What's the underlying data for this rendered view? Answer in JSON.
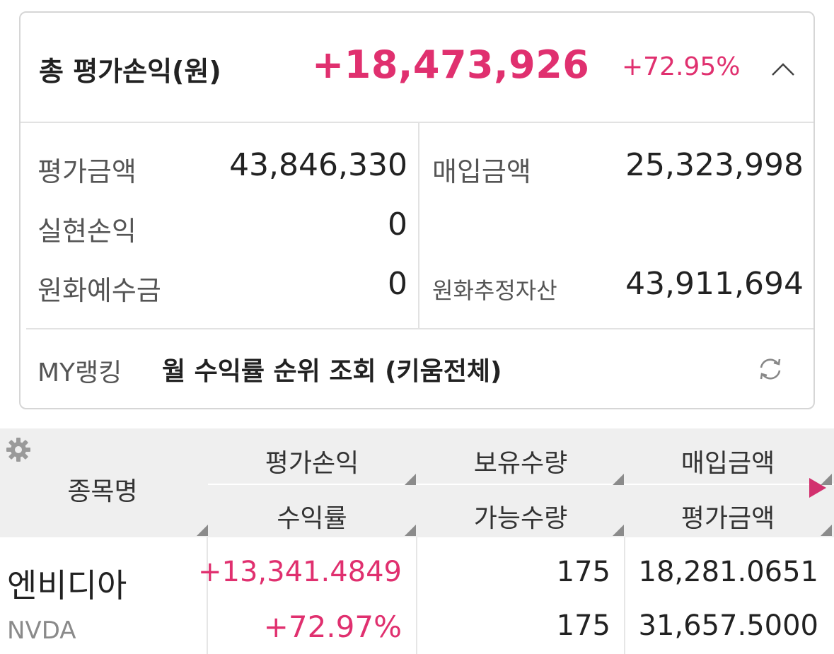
{
  "summary": {
    "total_label": "총 평가손익(원)",
    "total_value": "+18,473,926",
    "total_rate": "+72.95%",
    "eval_amount_label": "평가금액",
    "eval_amount_value": "43,846,330",
    "purchase_amount_label": "매입금액",
    "purchase_amount_value": "25,323,998",
    "realized_pl_label": "실현손익",
    "realized_pl_value": "0",
    "krw_deposit_label": "원화예수금",
    "krw_deposit_value": "0",
    "krw_est_assets_label": "원화추정자산",
    "krw_est_assets_value": "43,911,694"
  },
  "ranking": {
    "label": "MY랭킹",
    "title": "월 수익률 순위 조회 (키움전체)"
  },
  "table": {
    "headers": {
      "name": "종목명",
      "eval_pl": "평가손익",
      "return_rate": "수익률",
      "holding_qty": "보유수량",
      "available_qty": "가능수량",
      "purchase_amount": "매입금액",
      "eval_amount": "평가금액"
    },
    "rows": [
      {
        "name": "엔비디아",
        "ticker": "NVDA",
        "eval_pl": "+13,341.4849",
        "return_rate": "+72.97%",
        "holding_qty": "175",
        "available_qty": "175",
        "purchase_amount": "18,281.0651",
        "eval_amount": "31,657.5000"
      }
    ]
  },
  "icons": {
    "collapse": "chevron-up-icon",
    "refresh": "refresh-icon",
    "settings": "gear-icon",
    "next": "triangle-right-icon"
  },
  "colors": {
    "positive": "#e0306f",
    "next_arrow": "#d2306e"
  }
}
